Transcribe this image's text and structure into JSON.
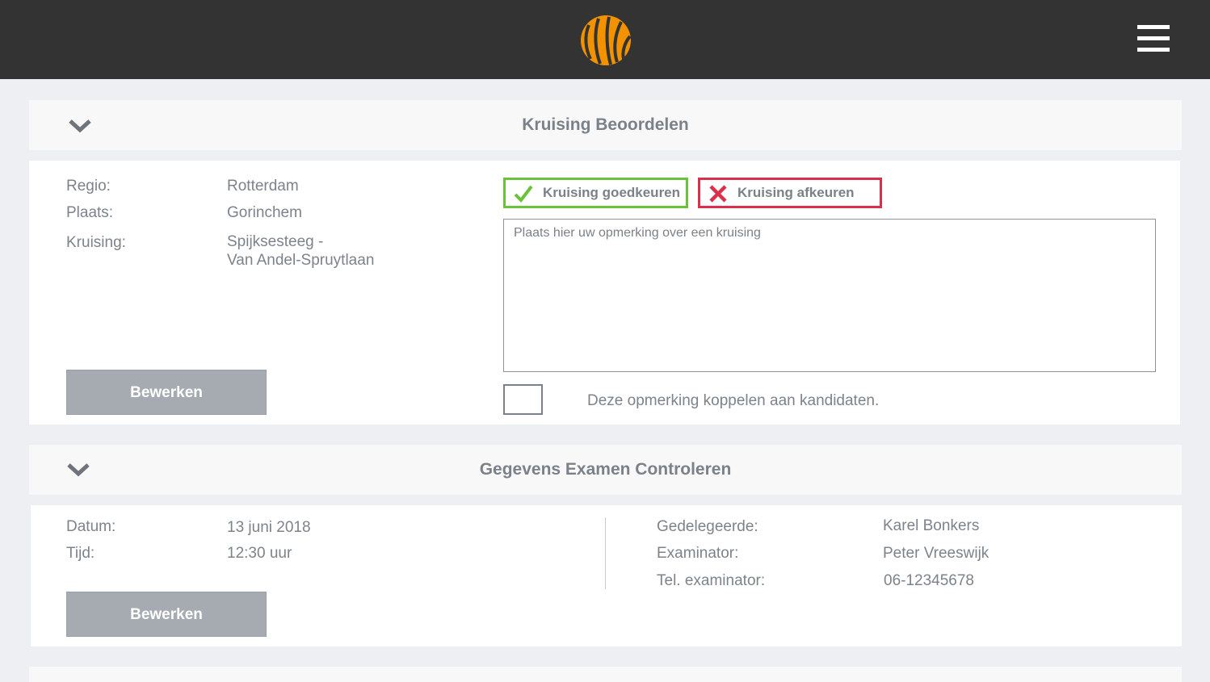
{
  "header": {
    "logo_icon": "tiger-stripes-logo",
    "menu_icon": "hamburger-menu-icon",
    "accent_color": "#f39200"
  },
  "kruising": {
    "title": "Kruising Beoordelen",
    "labels": {
      "regio": "Regio:",
      "plaats": "Plaats:",
      "kruising": "Kruising:"
    },
    "values": {
      "regio": "Rotterdam",
      "plaats": "Gorinchem",
      "kruising_line1": "Spijksesteeg -",
      "kruising_line2": "Van Andel-Spruytlaan"
    },
    "edit_label": "Bewerken",
    "approve_label": "Kruising goedkeuren",
    "reject_label": "Kruising afkeuren",
    "remark_placeholder": "Plaats hier uw opmerking over een kruising",
    "remark_value": "",
    "link_label": "Deze opmerking koppelen aan kandidaten.",
    "approve_color": "#6ac23a",
    "reject_color": "#d9314b"
  },
  "examen": {
    "title": "Gegevens Examen Controleren",
    "labels": {
      "datum": "Datum:",
      "tijd": "Tijd:",
      "gedelegeerde": "Gedelegeerde:",
      "examinator": "Examinator:",
      "tel": "Tel. examinator:"
    },
    "values": {
      "datum": "13 juni 2018",
      "tijd": "12:30 uur",
      "gedelegeerde": "Karel Bonkers",
      "examinator": "Peter Vreeswijk",
      "tel": "06-12345678"
    },
    "edit_label": "Bewerken"
  }
}
